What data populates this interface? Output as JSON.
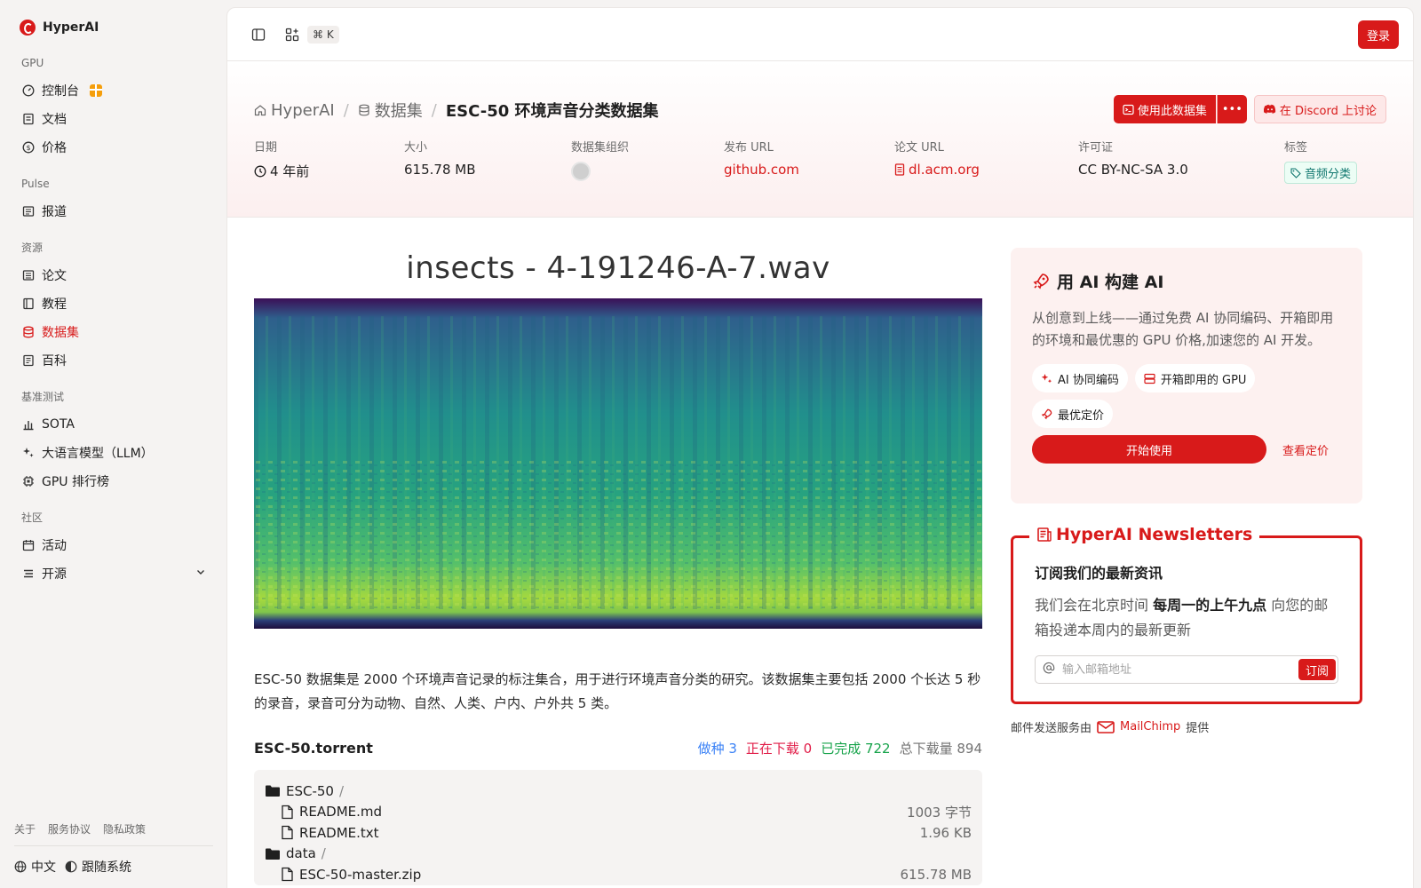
{
  "app": {
    "name": "HyperAI"
  },
  "sidebar": {
    "sections": [
      {
        "title": "GPU",
        "items": [
          {
            "label": "控制台",
            "icon": "gauge-icon",
            "gift": true
          },
          {
            "label": "文档",
            "icon": "book-icon"
          },
          {
            "label": "价格",
            "icon": "dollar-icon"
          }
        ]
      },
      {
        "title": "Pulse",
        "items": [
          {
            "label": "报道",
            "icon": "newspaper-icon"
          }
        ]
      },
      {
        "title": "资源",
        "items": [
          {
            "label": "论文",
            "icon": "document-icon"
          },
          {
            "label": "教程",
            "icon": "notebook-icon"
          },
          {
            "label": "数据集",
            "icon": "database-icon",
            "active": true
          },
          {
            "label": "百科",
            "icon": "encyclopedia-icon"
          }
        ]
      },
      {
        "title": "基准测试",
        "items": [
          {
            "label": "SOTA",
            "icon": "bar-chart-icon"
          },
          {
            "label": "大语言模型（LLM）",
            "icon": "sparkles-icon"
          },
          {
            "label": "GPU 排行榜",
            "icon": "chip-icon"
          }
        ]
      },
      {
        "title": "社区",
        "items": [
          {
            "label": "活动",
            "icon": "calendar-icon"
          },
          {
            "label": "开源",
            "icon": "list-icon",
            "expandable": true
          }
        ]
      }
    ],
    "footer_links": [
      "关于",
      "服务协议",
      "隐私政策"
    ],
    "language": "中文",
    "theme": "跟随系统"
  },
  "topbar": {
    "shortcut": "⌘ K",
    "login": "登录"
  },
  "breadcrumb": {
    "home": "HyperAI",
    "section": "数据集",
    "current": "ESC-50 环境声音分类数据集"
  },
  "actions": {
    "use_dataset": "使用此数据集",
    "more": "•••",
    "discord": "在 Discord 上讨论"
  },
  "meta": {
    "date_label": "日期",
    "date_value": "4 年前",
    "size_label": "大小",
    "size_value": "615.78 MB",
    "org_label": "数据集组织",
    "release_label": "发布 URL",
    "release_value": "github.com",
    "paper_label": "论文 URL",
    "paper_value": "dl.acm.org",
    "license_label": "许可证",
    "license_value": "CC BY-NC-SA 3.0",
    "tags_label": "标签",
    "tag_value": "音频分类"
  },
  "spectrogram": {
    "title": "insects - 4-191246-A-7.wav"
  },
  "description": "ESC-50 数据集是 2000 个环境声音记录的标注集合，用于进行环境声音分类的研究。该数据集主要包括 2000 个长达 5 秒的录音，录音可分为动物、自然、人类、户内、户外共 5 类。",
  "torrent": {
    "name": "ESC-50.torrent",
    "seeding": "做种 3",
    "downloading": "正在下载 0",
    "completed": "已完成 722",
    "total": "总下载量 894",
    "files": [
      {
        "name": "ESC-50",
        "type": "folder",
        "size": ""
      },
      {
        "name": "README.md",
        "type": "file",
        "size": "1003 字节"
      },
      {
        "name": "README.txt",
        "type": "file",
        "size": "1.96 KB"
      },
      {
        "name": "data",
        "type": "folder",
        "size": ""
      },
      {
        "name": "ESC-50-master.zip",
        "type": "file",
        "size": "615.78 MB"
      }
    ]
  },
  "promo": {
    "title": "用 AI 构建 AI",
    "text": "从创意到上线——通过免费 AI 协同编码、开箱即用的环境和最优惠的 GPU 价格,加速您的 AI 开发。",
    "chips": [
      "AI 协同编码",
      "开箱即用的 GPU",
      "最优定价"
    ],
    "start": "开始使用",
    "pricing": "查看定价"
  },
  "newsletter": {
    "legend": "HyperAI Newsletters",
    "heading": "订阅我们的最新资讯",
    "text_before": "我们会在北京时间 ",
    "text_bold": "每周一的上午九点",
    "text_after": " 向您的邮箱投递本周内的最新更新",
    "placeholder": "输入邮箱地址",
    "subscribe": "订阅"
  },
  "mailchimp": {
    "prefix": "邮件发送服务由",
    "brand": "MailChimp",
    "suffix": "提供"
  },
  "colors": {
    "accent": "#d81a1a"
  }
}
